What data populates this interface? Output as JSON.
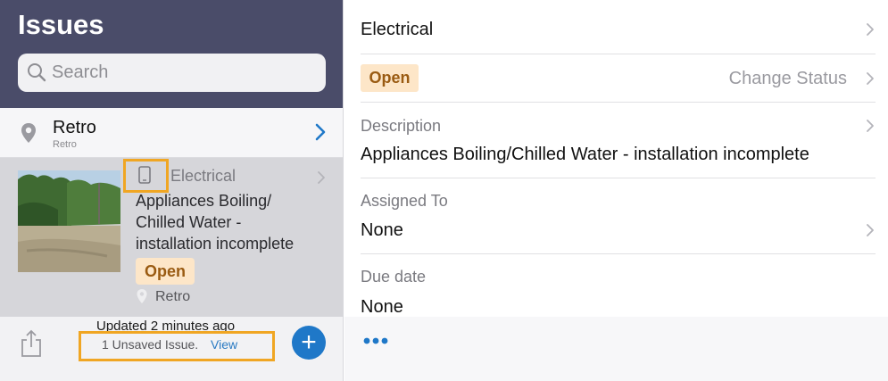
{
  "list": {
    "title": "Issues",
    "search_placeholder": "Search",
    "location": {
      "name": "Retro",
      "subtitle": "Retro"
    },
    "issue": {
      "category": "Electrical",
      "title": "Appliances Boiling/ Chilled Water - installation incomplete",
      "status": "Open",
      "location": "Retro"
    },
    "footer": {
      "updated": "Updated 2 minutes ago",
      "unsaved": "1 Unsaved Issue.",
      "view_label": "View",
      "add_label": "+"
    }
  },
  "detail": {
    "category": "Electrical",
    "status": "Open",
    "change_status_label": "Change Status",
    "description_label": "Description",
    "description": "Appliances Boiling/Chilled Water - installation incomplete",
    "assigned_label": "Assigned To",
    "assigned_value": "None",
    "due_label": "Due date",
    "due_value": "None"
  },
  "icons": [
    "search-icon",
    "location-pin-icon",
    "chevron-right-icon",
    "device-icon",
    "share-icon",
    "plus-icon",
    "more-icon"
  ],
  "colors": {
    "header": "#4a4c69",
    "status_badge_bg": "#fde6c8",
    "status_badge_text": "#9a5b12",
    "accent": "#1f78c8",
    "highlight": "#f0a623"
  }
}
